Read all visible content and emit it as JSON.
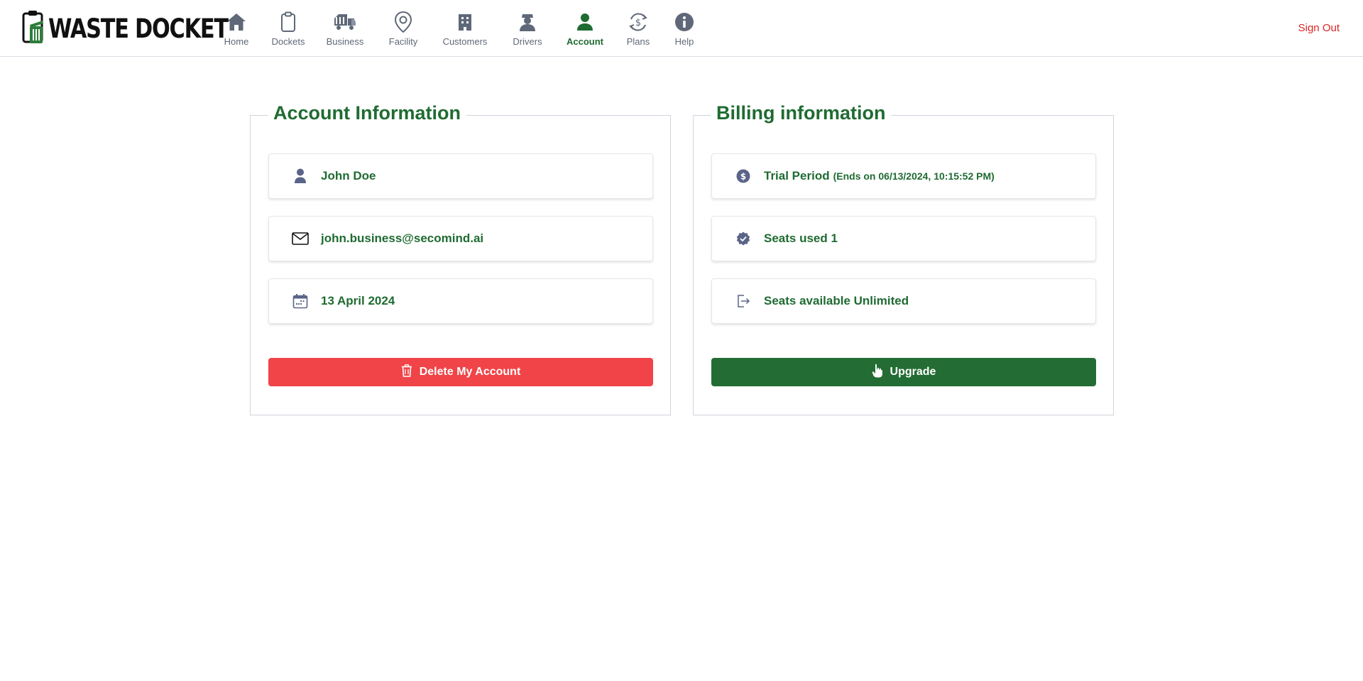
{
  "app": {
    "logo_text": "WASTE DOCKET"
  },
  "nav": {
    "items": [
      {
        "label": "Home",
        "icon": "home-icon",
        "active": false
      },
      {
        "label": "Dockets",
        "icon": "clipboard-icon",
        "active": false
      },
      {
        "label": "Business",
        "icon": "truck-icon",
        "active": false
      },
      {
        "label": "Facility",
        "icon": "map-pin-icon",
        "active": false
      },
      {
        "label": "Customers",
        "icon": "building-icon",
        "active": false
      },
      {
        "label": "Drivers",
        "icon": "driver-icon",
        "active": false
      },
      {
        "label": "Account",
        "icon": "user-icon",
        "active": true
      },
      {
        "label": "Plans",
        "icon": "dollar-cycle-icon",
        "active": false
      },
      {
        "label": "Help",
        "icon": "info-icon",
        "active": false
      }
    ],
    "signout_label": "Sign Out"
  },
  "account": {
    "title": "Account Information",
    "name": "John Doe",
    "email": "john.business@secomind.ai",
    "date": "13 April 2024",
    "delete_label": "Delete My Account"
  },
  "billing": {
    "title": "Billing information",
    "plan": "Trial Period",
    "plan_note": "(Ends on 06/13/2024, 10:15:52 PM)",
    "seats_used": "Seats used 1",
    "seats_available": "Seats available Unlimited",
    "upgrade_label": "Upgrade"
  },
  "colors": {
    "brand_green": "#1f6b32",
    "danger_red": "#f04448",
    "button_green": "#236d34",
    "icon_gray": "#5f6878",
    "signout_red": "#dc2626"
  }
}
